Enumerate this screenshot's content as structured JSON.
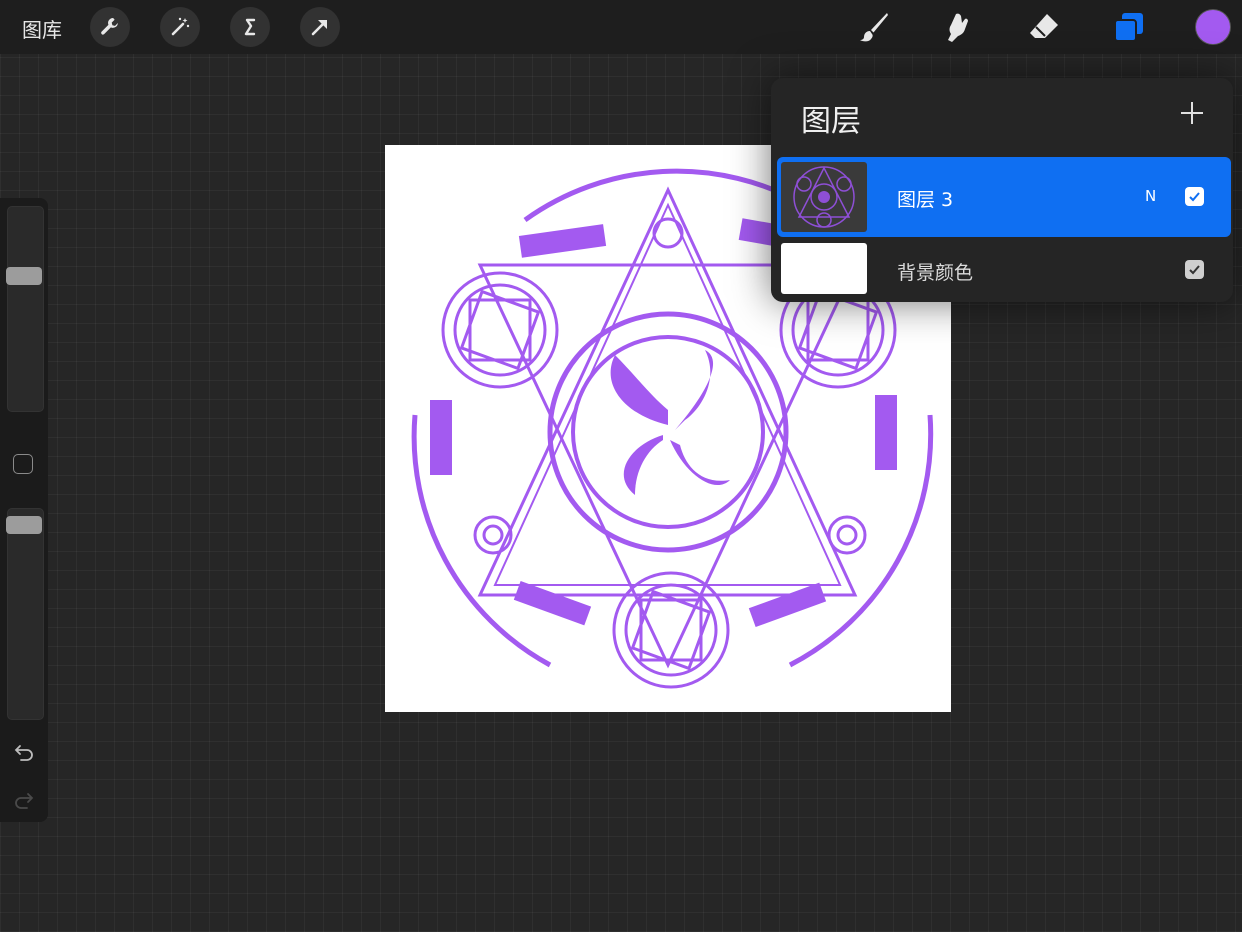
{
  "topbar": {
    "gallery_label": "图库",
    "left_tools": [
      "wrench-icon",
      "magic-wand-icon",
      "selection-icon",
      "transform-icon"
    ],
    "right_tools": [
      "brush-icon",
      "smudge-icon",
      "eraser-icon",
      "layers-icon"
    ],
    "current_color": "#a35af0",
    "accent_color": "#0f6ff2"
  },
  "sidebar": {
    "brush_size_level": 0.33,
    "opacity_level": 0.04
  },
  "layers_panel": {
    "title": "图层",
    "layers": [
      {
        "name": "图层 3",
        "blend_mode": "N",
        "visible": true,
        "selected": true
      },
      {
        "name": "背景颜色",
        "visible": true,
        "selected": false
      }
    ]
  }
}
